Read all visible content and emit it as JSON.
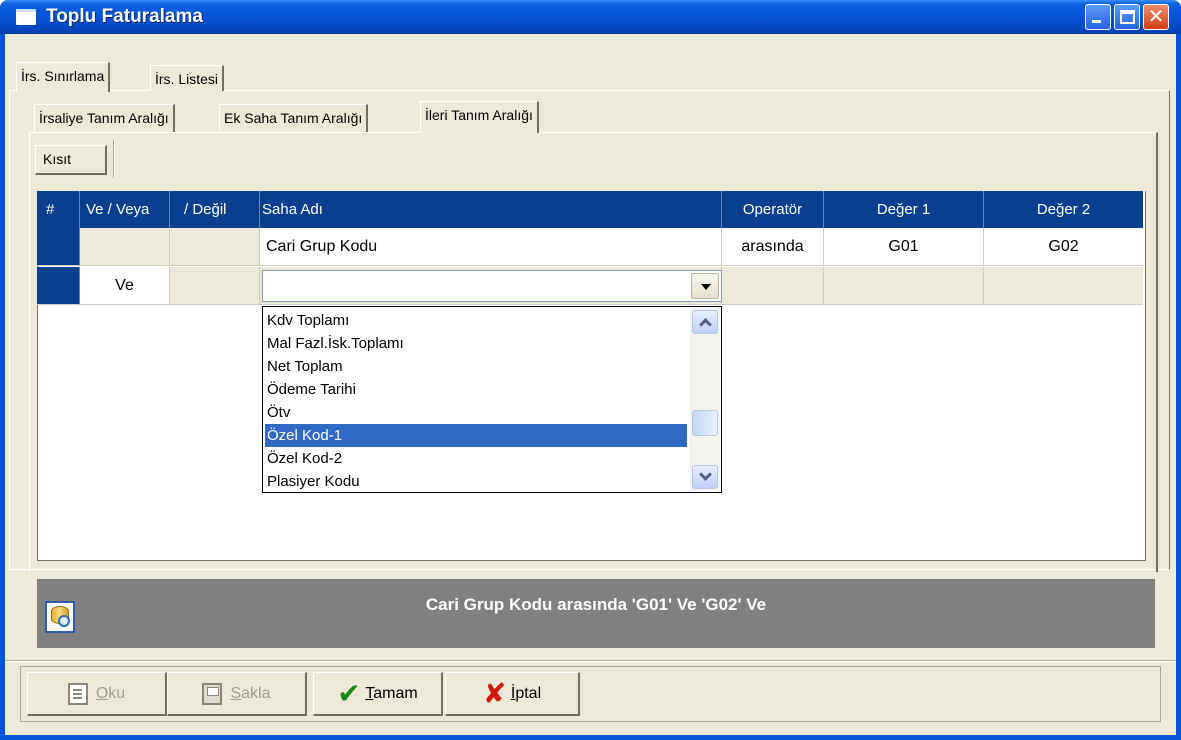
{
  "window": {
    "title": "Toplu Faturalama"
  },
  "outer_tabs": [
    {
      "label": "İrs. Sınırlama",
      "active": true
    },
    {
      "label": "İrs. Listesi",
      "active": false
    }
  ],
  "inner_tabs": [
    {
      "label": "İrsaliye Tanım Aralığı",
      "active": false
    },
    {
      "label": "Ek Saha Tanım Aralığı",
      "active": false
    },
    {
      "label": "İleri Tanım Aralığı",
      "active": true
    }
  ],
  "kisit_tab": {
    "label": "Kısıt"
  },
  "grid": {
    "headers": [
      "#",
      "Ve / Veya",
      "/ Değil",
      "Saha Adı",
      "Operatör",
      "Değer 1",
      "Değer 2"
    ],
    "rows": [
      {
        "num": "",
        "ve_veya": "",
        "degil": "",
        "saha_adi": "Cari Grup Kodu",
        "operator": "arasında",
        "deger1": "G01",
        "deger2": "G02"
      },
      {
        "num": "",
        "ve_veya": "Ve",
        "degil": "",
        "saha_adi": "",
        "operator": "",
        "deger1": "",
        "deger2": ""
      }
    ]
  },
  "dropdown": {
    "value": "",
    "options": [
      "Kdv Toplamı",
      "Mal Fazl.İsk.Toplamı",
      "Net Toplam",
      "Ödeme Tarihi",
      "Ötv",
      "Özel Kod-1",
      "Özel Kod-2",
      "Plasiyer Kodu"
    ],
    "selected_index": 5
  },
  "summary": {
    "text": "Cari Grup Kodu arasında 'G01' Ve 'G02' Ve"
  },
  "buttons": {
    "oku": {
      "label": "Oku",
      "underline": "O",
      "rest": "ku",
      "enabled": false,
      "icon": "read-doc-icon"
    },
    "sakla": {
      "label": "Sakla",
      "underline": "S",
      "rest": "akla",
      "enabled": false,
      "icon": "save-disk-icon"
    },
    "tamam": {
      "label": "Tamam",
      "underline": "T",
      "rest": "amam",
      "enabled": true,
      "icon": "checkmark-icon"
    },
    "iptal": {
      "label": "İptal",
      "underline": "İ",
      "rest": "ptal",
      "enabled": true,
      "icon": "red-x-icon"
    }
  },
  "colors": {
    "grid_header": "#0a3f8f",
    "selection": "#316ac5",
    "summary_bg": "#808080"
  }
}
